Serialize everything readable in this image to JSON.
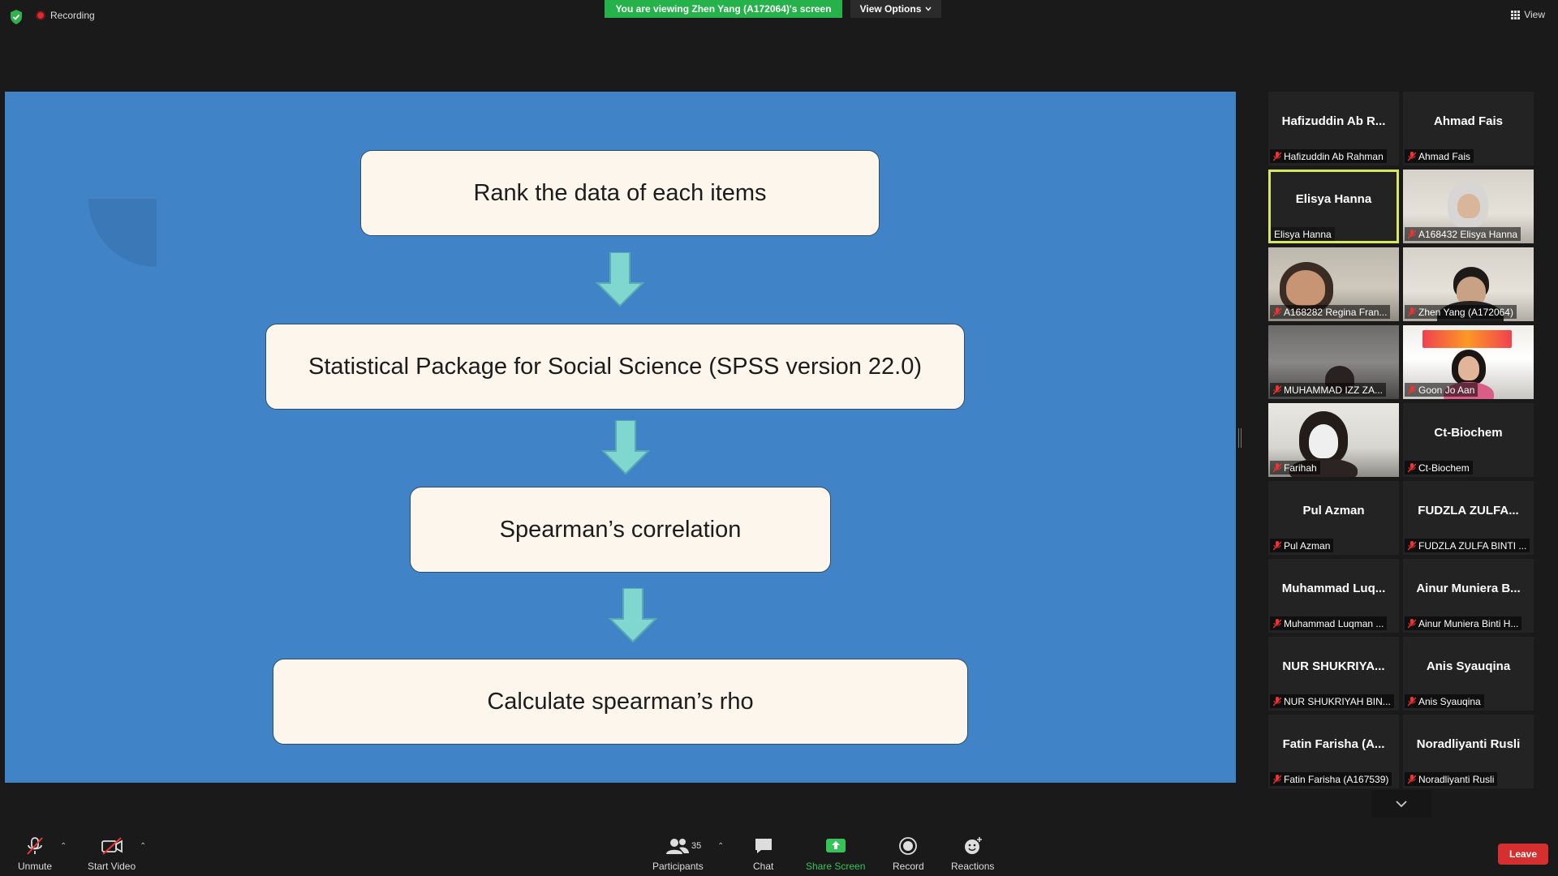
{
  "window": {
    "recording_label": "Recording",
    "viewing_banner": "You are viewing Zhen Yang (A172064)'s screen",
    "view_options_label": "View Options",
    "view_label": "View"
  },
  "slide": {
    "steps": [
      "Rank the data of each items",
      "Statistical Package for Social Science (SPSS version 22.0)",
      "Spearman’s correlation",
      "Calculate spearman’s rho"
    ]
  },
  "gallery": {
    "tiles": [
      {
        "center_name": "Hafizuddin  Ab  R...",
        "label": "Hafizuddin Ab Rahman",
        "muted": true,
        "video": "none"
      },
      {
        "center_name": "Ahmad Fais",
        "label": "Ahmad Fais",
        "muted": true,
        "video": "none"
      },
      {
        "center_name": "Elisya Hanna",
        "label": "Elisya Hanna",
        "muted": false,
        "video": "none",
        "active": true
      },
      {
        "center_name": "",
        "label": "A168432 Elisya Hanna",
        "muted": true,
        "video": "person"
      },
      {
        "center_name": "",
        "label": "A168282 Regina Fran...",
        "muted": true,
        "video": "person"
      },
      {
        "center_name": "",
        "label": "Zhen Yang (A172064)",
        "muted": true,
        "video": "person"
      },
      {
        "center_name": "",
        "label": "MUHAMMAD IZZ ZA...",
        "muted": true,
        "video": "person"
      },
      {
        "center_name": "",
        "label": "Goon Jo Aan",
        "muted": true,
        "video": "person"
      },
      {
        "center_name": "",
        "label": "Farihah",
        "muted": true,
        "video": "person"
      },
      {
        "center_name": "Ct-Biochem",
        "label": "Ct-Biochem",
        "muted": true,
        "video": "none"
      },
      {
        "center_name": "Pul Azman",
        "label": "Pul Azman",
        "muted": true,
        "video": "none"
      },
      {
        "center_name": "FUDZLA  ZULFA...",
        "label": "FUDZLA ZULFA BINTI ...",
        "muted": true,
        "video": "none"
      },
      {
        "center_name": "Muhammad  Luq...",
        "label": "Muhammad Luqman ...",
        "muted": true,
        "video": "none"
      },
      {
        "center_name": "Ainur  Muniera  B...",
        "label": "Ainur Muniera Binti H...",
        "muted": true,
        "video": "none"
      },
      {
        "center_name": "NUR  SHUKRIYA...",
        "label": "NUR SHUKRIYAH BIN...",
        "muted": true,
        "video": "none"
      },
      {
        "center_name": "Anis Syauqina",
        "label": "Anis Syauqina",
        "muted": true,
        "video": "none"
      },
      {
        "center_name": "Fatin Farisha  (A...",
        "label": "Fatin Farisha (A167539)",
        "muted": true,
        "video": "none"
      },
      {
        "center_name": "Noradliyanti Rusli",
        "label": "Noradliyanti Rusli",
        "muted": true,
        "video": "none"
      }
    ]
  },
  "toolbar": {
    "unmute_label": "Unmute",
    "start_video_label": "Start Video",
    "participants_label": "Participants",
    "participants_count": "35",
    "chat_label": "Chat",
    "share_screen_label": "Share Screen",
    "record_label": "Record",
    "reactions_label": "Reactions",
    "leave_label": "Leave"
  },
  "colors": {
    "slide_bg": "#4083c6",
    "banner_green": "#26b24b",
    "leave_red": "#d62f2f",
    "active_speaker": "#d8e85a",
    "arrow_fill": "#7fd7cf"
  }
}
